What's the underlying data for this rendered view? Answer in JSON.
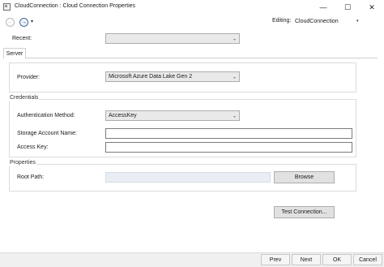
{
  "window": {
    "title": "CloudConnection : Cloud Connection Properties",
    "minimize_glyph": "—",
    "maximize_glyph": "☐",
    "close_glyph": "✕"
  },
  "toolbar": {
    "back_glyph": "←",
    "forward_glyph": "→",
    "dropdown_glyph": "▾",
    "editing_label": "Editing:",
    "editing_value": "CloudConnection"
  },
  "recent": {
    "label": "Recent:",
    "value": ""
  },
  "tabs": [
    {
      "label": "Server"
    }
  ],
  "provider": {
    "label": "Provider:",
    "value": "Microsoft Azure Data Lake Gen 2"
  },
  "credentials": {
    "title": "Credentials",
    "auth_method_label": "Authentication Method:",
    "auth_method_value": "AccessKey",
    "storage_account_label": "Storage Account Name:",
    "storage_account_value": "",
    "access_key_label": "Access Key:",
    "access_key_value": ""
  },
  "properties": {
    "title": "Properties",
    "root_path_label": "Root Path:",
    "root_path_value": "",
    "browse_label": "Browse"
  },
  "test_connection_label": "Test Connection...",
  "footer": {
    "prev_label": "Prev",
    "next_label": "Next",
    "ok_label": "OK",
    "cancel_label": "Cancel"
  },
  "caret_glyph": "⌄"
}
